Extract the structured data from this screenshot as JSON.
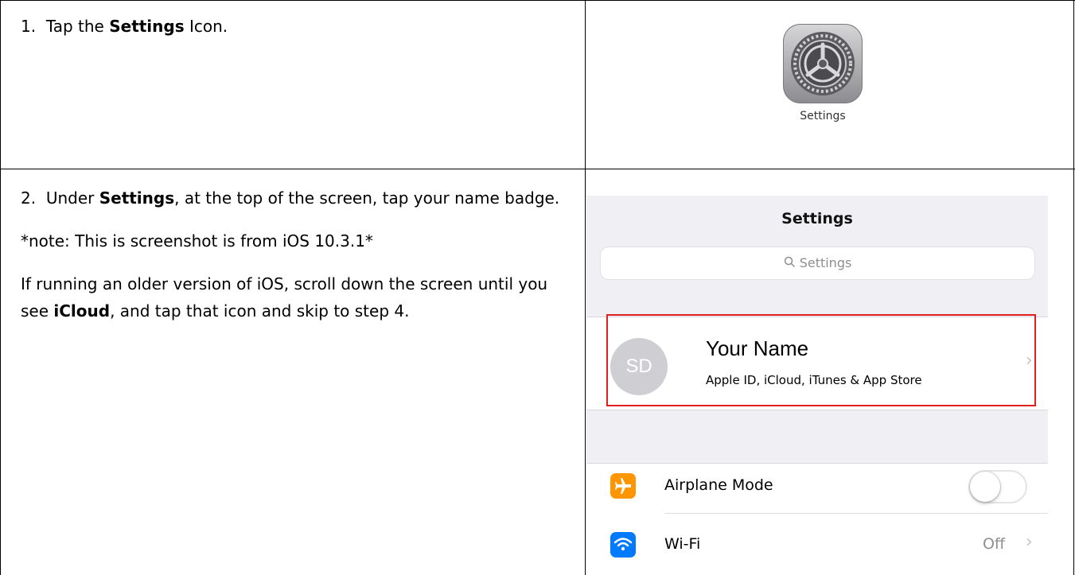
{
  "steps": [
    {
      "number": "1.",
      "text_before": "Tap the ",
      "bold": "Settings",
      "text_after": " Icon."
    },
    {
      "number": "2.",
      "text_before": "Under ",
      "bold": "Settings",
      "text_after": ", at the top of the screen, tap your name badge.",
      "note": "*note: This is screenshot is from iOS 10.3.1*",
      "older_before": "If running an older version of iOS, scroll down the screen until you see ",
      "older_bold": "iCloud",
      "older_after": ", and tap that icon and skip to step 4."
    }
  ],
  "app_icon": {
    "icon": "settings-gear-icon",
    "label": "Settings"
  },
  "phone": {
    "title": "Settings",
    "search_placeholder": "Settings",
    "profile": {
      "initials": "SD",
      "name": "Your Name",
      "subtitle": "Apple ID, iCloud, iTunes & App Store"
    },
    "rows": [
      {
        "label": "Airplane Mode",
        "icon": "airplane-icon",
        "icon_color": "#ff9500",
        "toggle_on": false
      },
      {
        "label": "Wi-Fi",
        "icon": "wifi-icon",
        "icon_color": "#007aff",
        "value": "Off"
      }
    ],
    "highlight_color": "#e02020"
  }
}
